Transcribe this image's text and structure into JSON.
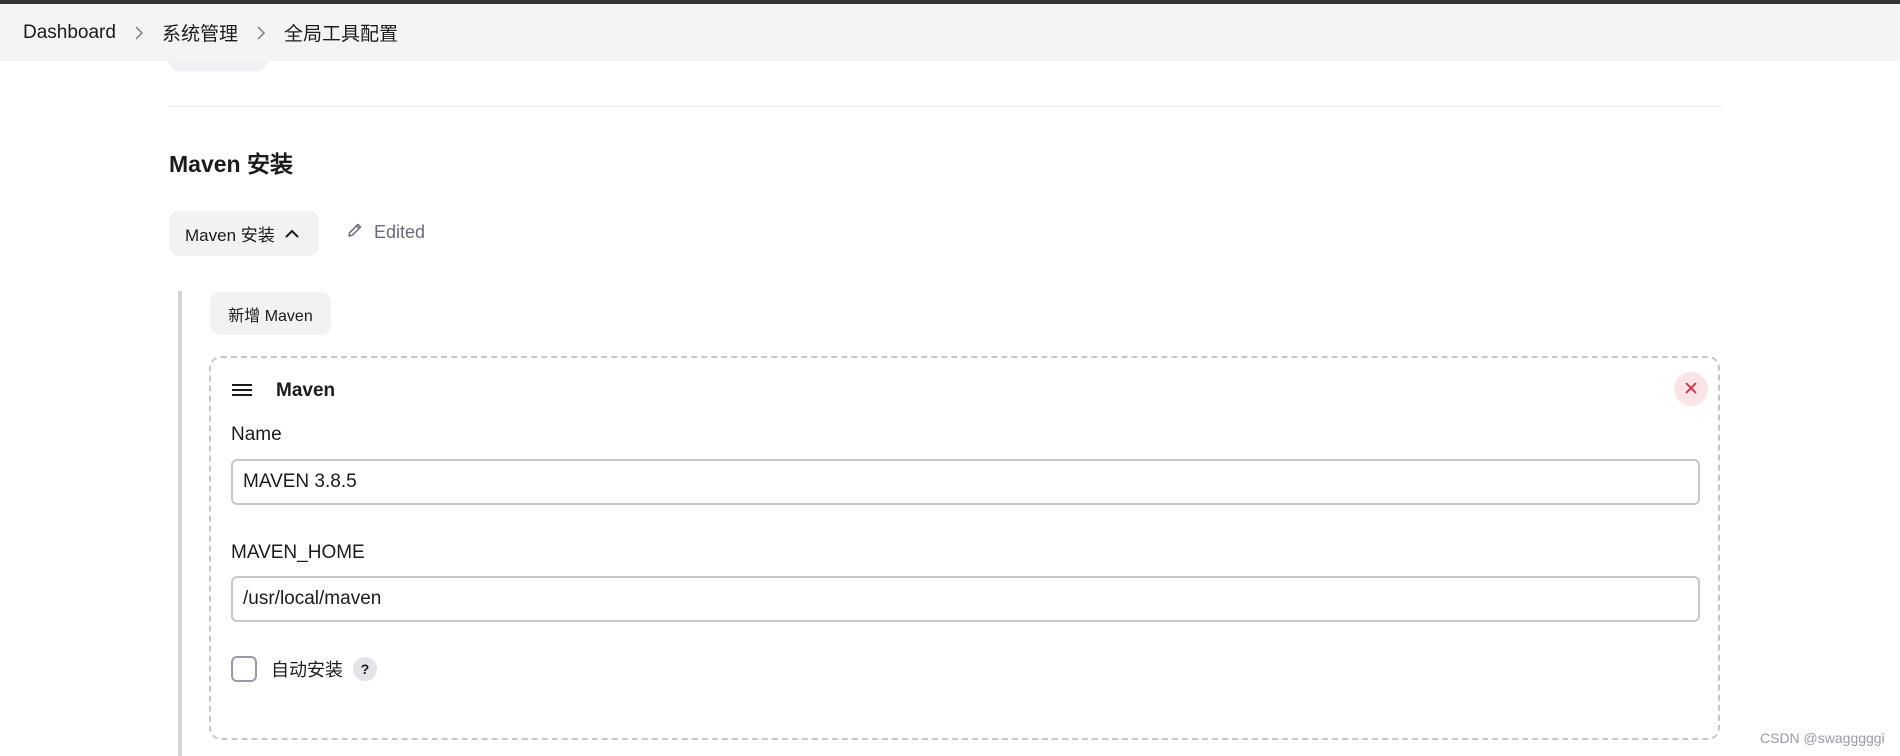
{
  "breadcrumb": {
    "items": [
      "Dashboard",
      "系统管理",
      "全局工具配置"
    ]
  },
  "section": {
    "title": "Maven 安装",
    "toggle_label": "Maven 安装",
    "edited_label": "Edited"
  },
  "installer": {
    "add_button_label": "新增 Maven",
    "card_title": "Maven",
    "name_label": "Name",
    "name_value": "MAVEN 3.8.5",
    "home_label": "MAVEN_HOME",
    "home_value": "/usr/local/maven",
    "auto_install_label": "自动安装",
    "auto_install_checked": false,
    "help_label": "?"
  },
  "watermark": "CSDN @swagggggi",
  "colors": {
    "close_accent": "#e0283a",
    "close_bg": "#fbe4e6",
    "breadcrumb_bg": "#f4f4f6"
  },
  "icons": {
    "breadcrumb_separator": "chevron-right-icon",
    "toggle": "chevron-up-icon",
    "edited": "pencil-icon",
    "drag": "drag-handle-icon",
    "close": "close-icon",
    "help": "help-icon"
  }
}
